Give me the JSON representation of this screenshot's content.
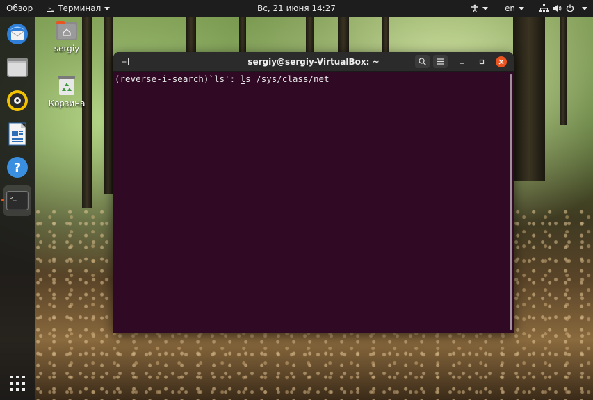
{
  "topbar": {
    "activities_label": "Обзор",
    "app_menu_label": "Терминал",
    "clock": "Вс, 21 июня  14:27",
    "language": "en"
  },
  "dock": {
    "items": [
      {
        "name": "thunderbird",
        "icon": "mail-icon"
      },
      {
        "name": "files",
        "icon": "folder-icon"
      },
      {
        "name": "rhythmbox",
        "icon": "music-icon"
      },
      {
        "name": "libreoffice-writer",
        "icon": "document-icon"
      },
      {
        "name": "help",
        "icon": "help-icon"
      },
      {
        "name": "terminal",
        "icon": "terminal-icon",
        "active": true
      }
    ],
    "show_apps_icon": "grid-icon"
  },
  "desktop": {
    "home_label": "sergiy",
    "trash_label": "Корзина"
  },
  "window": {
    "title": "sergiy@sergiy-VirtualBox: ~",
    "terminal": {
      "prompt": "(reverse-i-search)`ls': ",
      "cursor_char": "l",
      "rest": "s /sys/class/net"
    }
  },
  "colors": {
    "terminal_bg": "#300a24",
    "accent": "#e95420",
    "topbar_bg": "#1d1d1d"
  }
}
